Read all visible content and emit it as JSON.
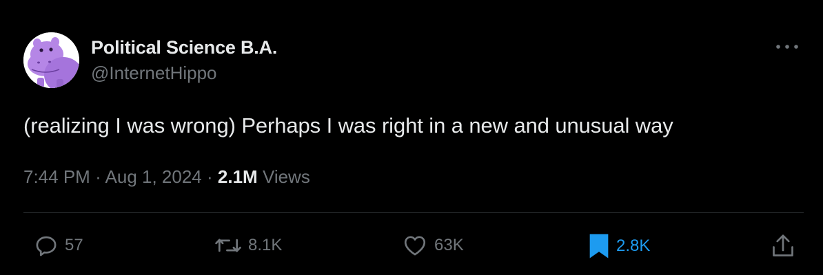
{
  "author": {
    "display_name": "Political Science B.A.",
    "handle": "@InternetHippo",
    "avatar_icon": "hippo-avatar-icon"
  },
  "tweet": {
    "text": "(realizing I was wrong) Perhaps I was right in a new and unusual way"
  },
  "meta": {
    "time": "7:44 PM",
    "separator": "·",
    "date": "Aug 1, 2024",
    "views_count": "2.1M",
    "views_label": "Views"
  },
  "actions": {
    "reply": {
      "icon": "reply-icon",
      "count": "57"
    },
    "retweet": {
      "icon": "retweet-icon",
      "count": "8.1K"
    },
    "like": {
      "icon": "heart-icon",
      "count": "63K"
    },
    "bookmark": {
      "icon": "bookmark-icon",
      "count": "2.8K",
      "active": true
    },
    "share": {
      "icon": "share-icon"
    }
  },
  "more_menu": {
    "icon": "more-dots-icon"
  },
  "colors": {
    "background": "#000000",
    "primary_text": "#e7e9ea",
    "secondary_text": "#71767b",
    "divider": "#2f3336",
    "accent_blue": "#1d9bf0",
    "avatar_purple": "#b586e6"
  }
}
